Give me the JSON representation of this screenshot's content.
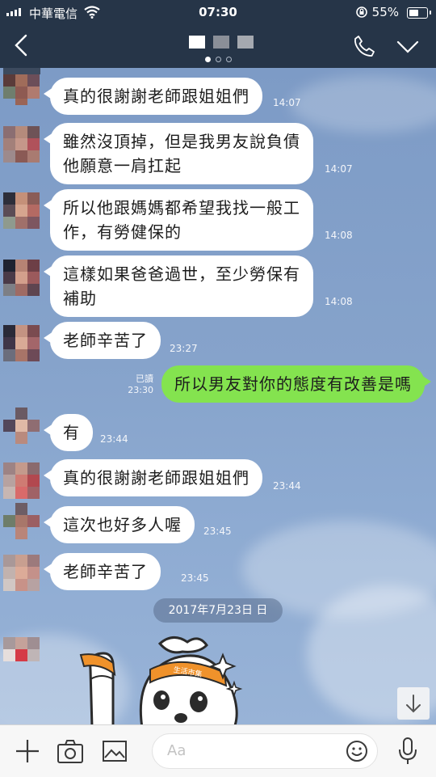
{
  "status_bar": {
    "carrier": "中華電信",
    "time": "07:30",
    "battery_percent": "55%",
    "battery_level": 0.55
  },
  "header": {
    "back_icon": "chevron-left-icon",
    "call_icon": "phone-icon",
    "menu_icon": "chevron-down-icon",
    "page_indicator": {
      "count": 3,
      "active_index": 0
    }
  },
  "messages": [
    {
      "direction": "in",
      "text": "真的很謝謝老師跟姐姐們",
      "time": "14:07"
    },
    {
      "direction": "in",
      "text": "雖然沒頂掉，但是我男友說負債\n他願意一肩扛起",
      "time": "14:07"
    },
    {
      "direction": "in",
      "text": "所以他跟媽媽都希望我找一般工\n作，有勞健保的",
      "time": "14:08"
    },
    {
      "direction": "in",
      "text": "這樣如果爸爸過世，至少勞保有\n補助",
      "time": "14:08"
    },
    {
      "direction": "in",
      "text": "老師辛苦了",
      "time": "23:27"
    },
    {
      "direction": "out",
      "text": "所以男友對你的態度有改善是嗎",
      "time": "23:30",
      "read_label": "已讀"
    },
    {
      "direction": "in",
      "text": "有",
      "time": "23:44"
    },
    {
      "direction": "in",
      "text": "真的很謝謝老師跟姐姐們",
      "time": "23:44"
    },
    {
      "direction": "in",
      "text": "這次也好多人喔",
      "time": "23:45"
    },
    {
      "direction": "in",
      "text": "老師辛苦了",
      "time": "23:45"
    }
  ],
  "date_divider": "2017年7月23日 日",
  "sticker": {
    "headband_text": "生活市集"
  },
  "input_bar": {
    "placeholder": "Aa",
    "icons": [
      "plus-icon",
      "camera-icon",
      "image-icon",
      "emoji-icon",
      "microphone-icon"
    ]
  },
  "colors": {
    "header_bg": "#263548",
    "chat_bg": "#7e9cc7",
    "incoming_bubble": "#ffffff",
    "outgoing_bubble": "#84e34f"
  }
}
